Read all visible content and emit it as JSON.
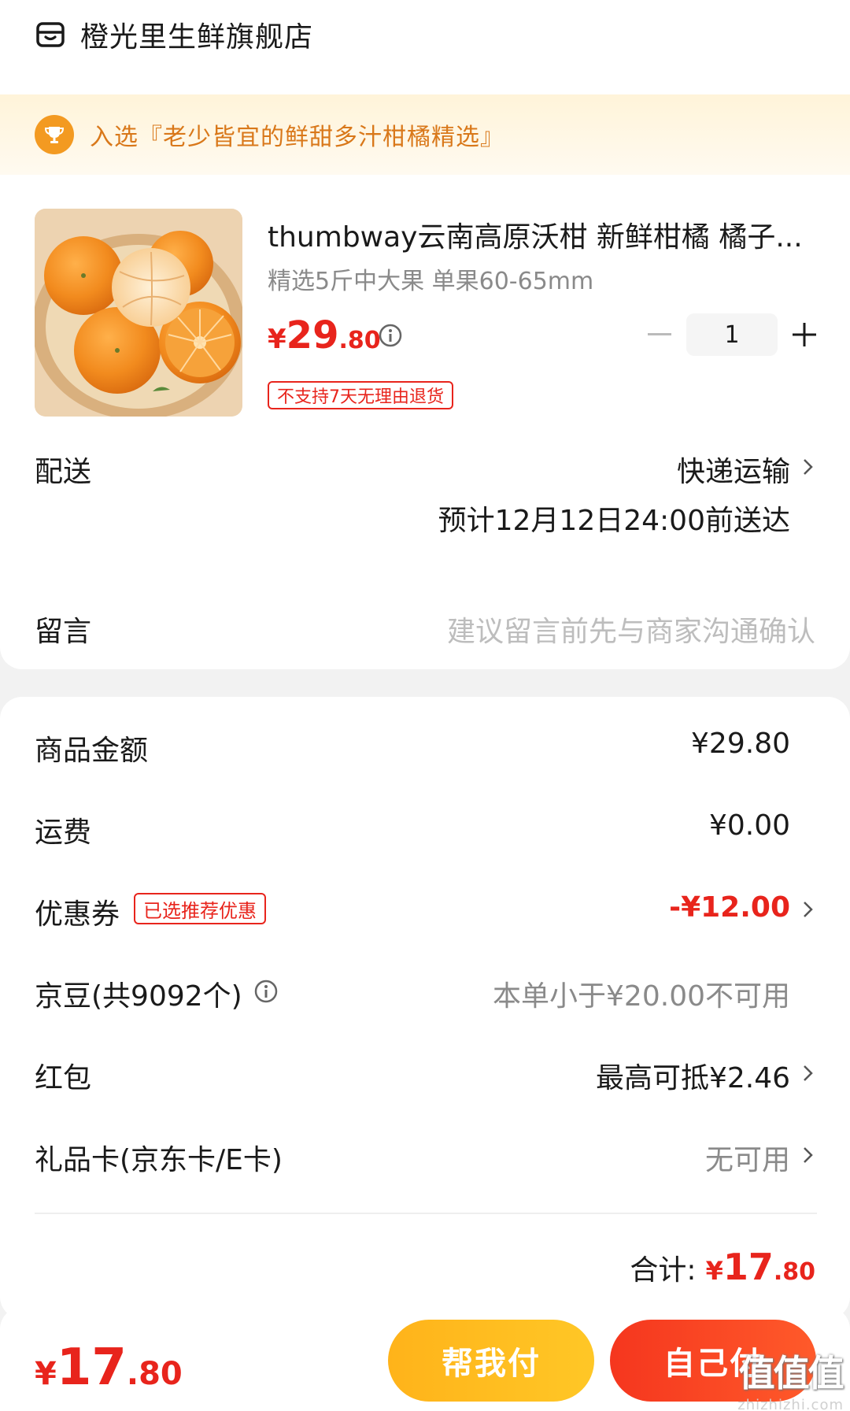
{
  "store": {
    "name": "橙光里生鲜旗舰店",
    "icon": "store-icon"
  },
  "banner": {
    "icon": "trophy-icon",
    "text": "入选『老少皆宜的鲜甜多汁柑橘精选』"
  },
  "product": {
    "title": "thumbway云南高原沃柑 新鲜柑橘 橘子...",
    "spec": "精选5斤中大果 单果60-65mm",
    "price_symbol": "¥",
    "price_int": "29",
    "price_dec": ".80",
    "return_policy": "不支持7天无理由退货",
    "quantity": "1",
    "minus": "minus-icon",
    "plus": "plus-icon"
  },
  "delivery": {
    "label": "配送",
    "method": "快递运输",
    "eta": "预计12月12日24:00前送达"
  },
  "memo": {
    "label": "留言",
    "placeholder": "建议留言前先与商家沟通确认"
  },
  "summary": {
    "goods_label": "商品金额",
    "goods_value": "¥29.80",
    "shipping_label": "运费",
    "shipping_value": "¥0.00",
    "coupon_label": "优惠券",
    "coupon_badge": "已选推荐优惠",
    "coupon_value": "-¥12.00",
    "jingdou_label": "京豆(共9092个)",
    "jingdou_value": "本单小于¥20.00不可用",
    "redpacket_label": "红包",
    "redpacket_value": "最高可抵¥2.46",
    "giftcard_label": "礼品卡(京东卡/E卡)",
    "giftcard_value": "无可用",
    "total_label": "合计:",
    "total_symbol": "¥",
    "total_int": "17",
    "total_dec": ".80"
  },
  "bottom": {
    "price_symbol": "¥",
    "price_int": "17",
    "price_dec": ".80",
    "help_pay": "帮我付",
    "self_pay": "自己付"
  },
  "watermark": {
    "logo": "值值值",
    "domain": "zhizhizhi.com"
  },
  "colors": {
    "accent_red": "#e8241c",
    "banner_orange": "#d9781a",
    "help_button": "#ffb31a",
    "self_button": "#f5361e"
  }
}
